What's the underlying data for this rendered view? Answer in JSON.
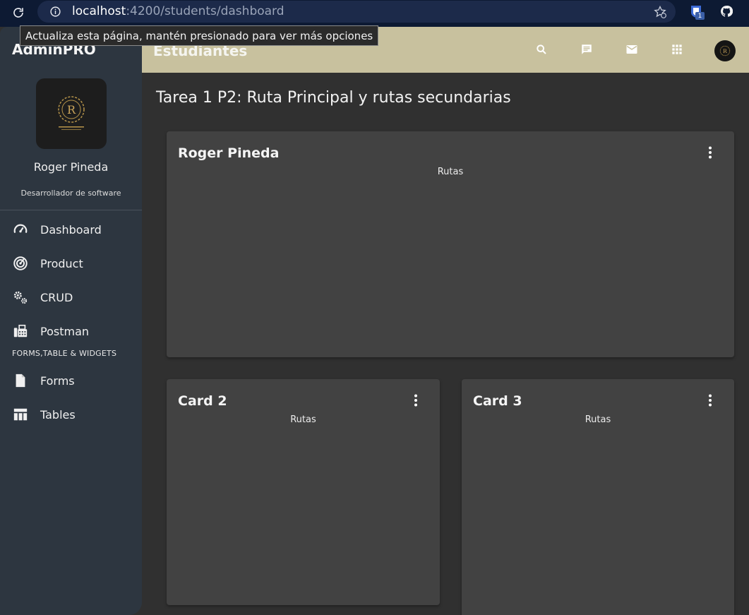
{
  "browser": {
    "url_host": "localhost",
    "url_path": ":4200/students/dashboard",
    "extension_badge": "1"
  },
  "tooltip": {
    "text": "Actualiza esta página, mantén presionado para ver más opciones"
  },
  "sidebar": {
    "brand": "AdminPRO",
    "profile_name": "Roger Pineda",
    "profile_role": "Desarrollador de software",
    "items": [
      {
        "label": "Dashboard",
        "icon": "speedometer-icon"
      },
      {
        "label": "Product",
        "icon": "radar-icon"
      },
      {
        "label": "CRUD",
        "icon": "gears-icon"
      },
      {
        "label": "Postman",
        "icon": "fax-icon"
      }
    ],
    "section_label": "FORMS,TABLE & WIDGETS",
    "items2": [
      {
        "label": "Forms",
        "icon": "document-icon"
      },
      {
        "label": "Tables",
        "icon": "table-icon"
      }
    ]
  },
  "header": {
    "title": "Estudiantes",
    "icons": [
      "search-icon",
      "message-icon",
      "mail-icon",
      "apps-icon"
    ]
  },
  "main": {
    "page_title": "Tarea 1 P2: Ruta Principal y rutas secundarias",
    "cards": [
      {
        "title": "Roger Pineda",
        "subtitle": "Rutas"
      },
      {
        "title": "Card 2",
        "subtitle": "Rutas"
      },
      {
        "title": "Card 3",
        "subtitle": "Rutas"
      }
    ]
  },
  "colors": {
    "topbar": "#c8c19e",
    "sidebar": "#2d3640",
    "background": "#303030",
    "card": "#424242"
  }
}
